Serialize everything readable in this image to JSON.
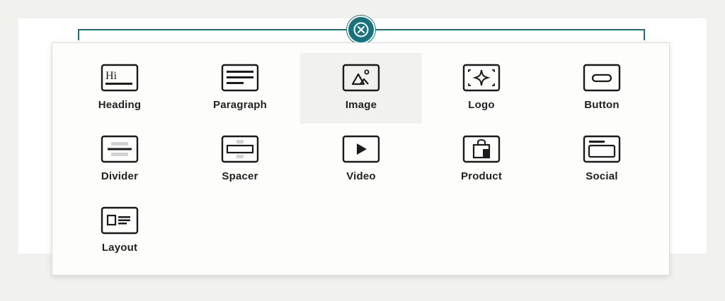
{
  "close_button": {
    "icon": "close-icon",
    "color": "#17737d"
  },
  "accent_color": "#16747e",
  "blocks": [
    {
      "label": "Heading",
      "icon": "heading-icon",
      "icon_text": "Hi",
      "selected": false
    },
    {
      "label": "Paragraph",
      "icon": "paragraph-icon",
      "selected": false
    },
    {
      "label": "Image",
      "icon": "image-icon",
      "selected": true
    },
    {
      "label": "Logo",
      "icon": "logo-icon",
      "selected": false
    },
    {
      "label": "Button",
      "icon": "button-icon",
      "selected": false
    },
    {
      "label": "Divider",
      "icon": "divider-icon",
      "selected": false
    },
    {
      "label": "Spacer",
      "icon": "spacer-icon",
      "selected": false
    },
    {
      "label": "Video",
      "icon": "video-icon",
      "selected": false
    },
    {
      "label": "Product",
      "icon": "product-icon",
      "selected": false
    },
    {
      "label": "Social",
      "icon": "social-icon",
      "selected": false
    },
    {
      "label": "Layout",
      "icon": "layout-icon",
      "selected": false
    }
  ]
}
